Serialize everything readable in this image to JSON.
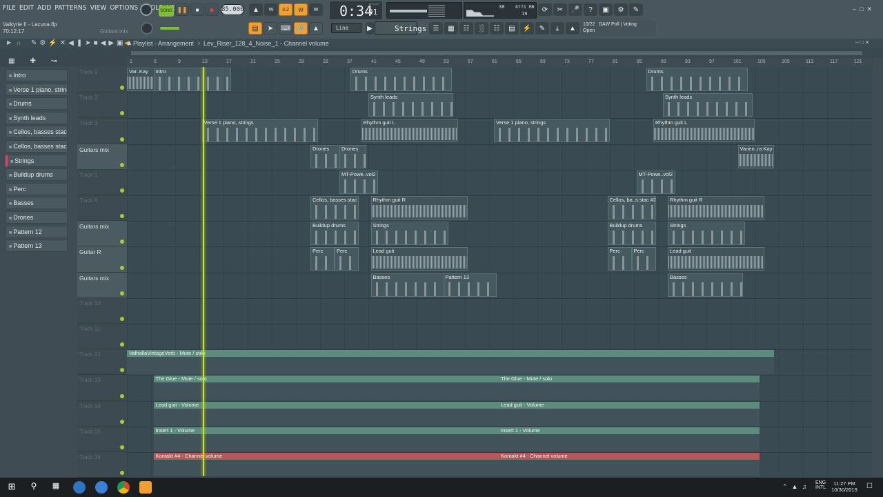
{
  "menu": [
    "FILE",
    "EDIT",
    "ADD",
    "PATTERNS",
    "VIEW",
    "OPTIONS",
    "TOOLS",
    "HELP"
  ],
  "transport": {
    "song_label": "SONG",
    "tempo": "85.000",
    "time": "0:34",
    "time_sub": "91",
    "time_unit": "M:S:CS",
    "memory": "8771 MB",
    "cpu_top": "38",
    "cpu_bottom": "19"
  },
  "file": {
    "name": "Valkyrie II - Lacuna.flp",
    "elapsed": "70:12:17",
    "channel_hint": "Guitars mix"
  },
  "snap": "Line",
  "pattern_selector": "Strings",
  "news": {
    "date": "10/22",
    "text": "DAW Poll | Voting",
    "sub": "Open"
  },
  "playlist": {
    "breadcrumb": "Playlist - Arrangement",
    "separator": "›",
    "current": "Lev_Riser_128_4_Noise_1 - Channel volume"
  },
  "ruler": [
    "1",
    "5",
    "9",
    "13",
    "17",
    "21",
    "25",
    "29",
    "33",
    "37",
    "41",
    "45",
    "49",
    "53",
    "57",
    "61",
    "65",
    "69",
    "73",
    "77",
    "81",
    "85",
    "89",
    "93",
    "97",
    "101",
    "105",
    "109",
    "113",
    "117",
    "121"
  ],
  "patterns": [
    "Intro",
    "Verse 1 piano, strings",
    "Drums",
    "Synth leads",
    "Cellos, basses stac",
    "Cellos, basses stac #2",
    "Strings",
    "Buildup drums",
    "Perc",
    "Basses",
    "Drones",
    "Pattern 12",
    "Pattern 13"
  ],
  "tracks": [
    {
      "name": "Track 1",
      "named": false
    },
    {
      "name": "Track 2",
      "named": false
    },
    {
      "name": "Track 3",
      "named": false
    },
    {
      "name": "Guitars mix",
      "named": true
    },
    {
      "name": "Track 5",
      "named": false
    },
    {
      "name": "Track 6",
      "named": false
    },
    {
      "name": "Guitars mix",
      "named": true
    },
    {
      "name": "Guitar R",
      "named": true
    },
    {
      "name": "Guitars mix",
      "named": true
    },
    {
      "name": "Track 10",
      "named": false
    },
    {
      "name": "Track 11",
      "named": false
    },
    {
      "name": "Track 12",
      "named": false
    },
    {
      "name": "Track 13",
      "named": false
    },
    {
      "name": "Track 14",
      "named": false
    },
    {
      "name": "Track 15",
      "named": false
    },
    {
      "name": "Track 16",
      "named": false
    }
  ],
  "clips": {
    "varkay": "Var..Kay",
    "intro": "Intro",
    "drums1": "Drums",
    "drums2": "Drums",
    "synth1": "Synth leads",
    "synth2": "Synth leads",
    "verse1": "Verse 1 piano, strings",
    "verse2": "Verse 1 piano, strings",
    "rhythmL1": "Rhythm guit L",
    "rhythmL2": "Rhythm guit L",
    "drones1": "Drones",
    "drones2": "Drones",
    "varien": "Varien..ra Kay",
    "mtpower1": "MT-Powe..vol2",
    "mtpower2": "MT-Powe..vol2",
    "cellos1": "Cellos, basses stac",
    "cellos2": "Cellos, ba..s stac #2",
    "rhythmR1": "Rhythm guit R",
    "rhythmR2": "Rhythm guit R",
    "buildup1": "Buildup drums",
    "buildup2": "Buildup drums",
    "strings1": "Strings",
    "strings2": "Strings",
    "perc1": "Perc",
    "perc2": "Perc",
    "perc3": "Perc",
    "perc4": "Perc",
    "lead1": "Lead guit",
    "lead2": "Lead guit",
    "basses1": "Basses",
    "basses2": "Basses",
    "pattern13": "Pattern 13"
  },
  "automation": {
    "valhalla": "ValhallaVintageVerb - Mute / solo",
    "glue1": "The Glue - Mute / solo",
    "glue2": "The Glue - Mute / solo",
    "leadvol1": "Lead guit - Volume",
    "leadvol2": "Lead guit - Volume",
    "insert1a": "Insert 1 - Volume",
    "insert1b": "Insert 1 - Volume",
    "kontakt1": "Kontakt #4 - Channel volume",
    "kontakt2": "Kontakt #4 - Channel volume"
  },
  "taskbar": {
    "lang": "ENG",
    "lang_sub": "INTL",
    "time": "11:27 PM",
    "date": "10/30/2019"
  },
  "colors": {
    "accent": "#f0a030",
    "playhead": "#c6e22b",
    "automation": "#5d8b7c",
    "automation_red": "#b5585c"
  }
}
